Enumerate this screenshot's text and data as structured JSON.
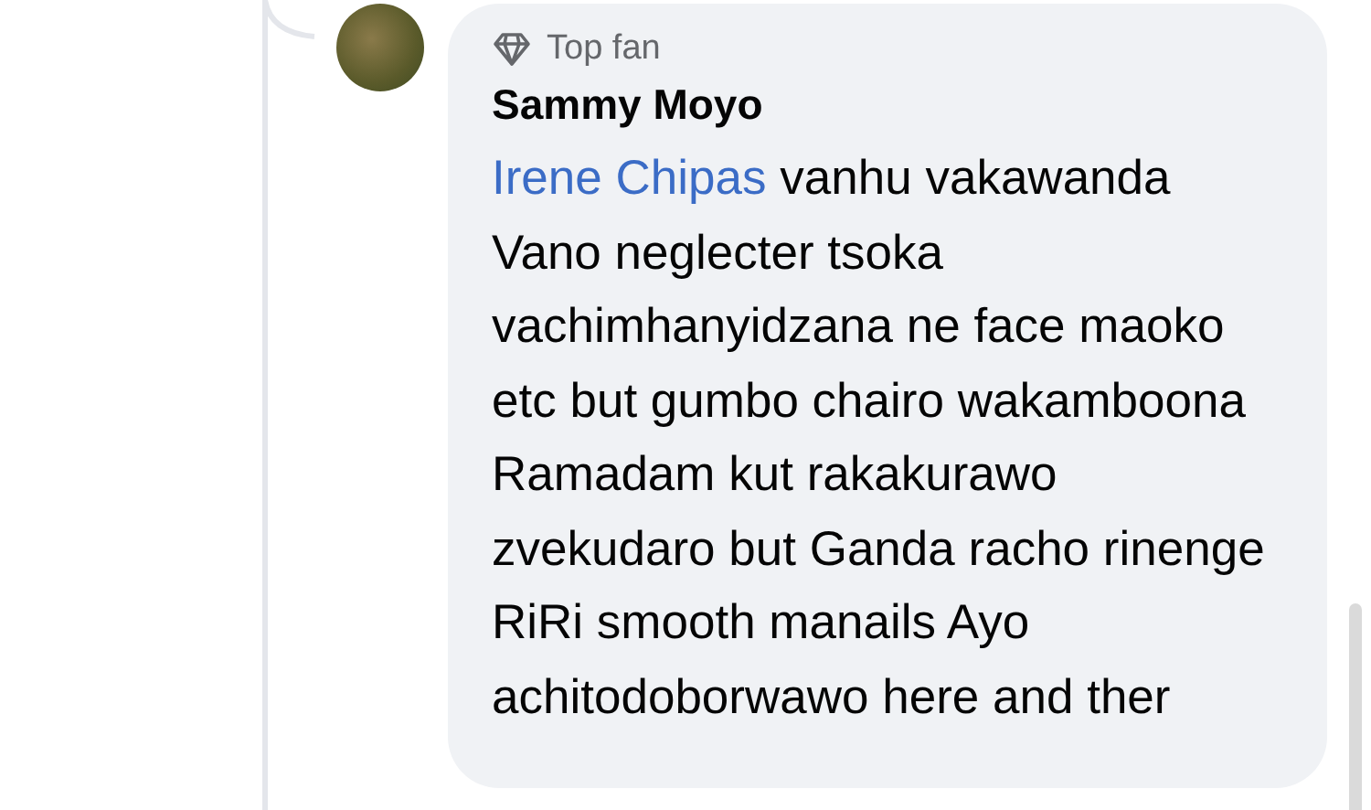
{
  "comment": {
    "badge": "Top fan",
    "author": "Sammy Moyo",
    "mention": "Irene Chipas",
    "text": "vanhu vakawanda Vano neglecter tsoka vachimhanyidzana ne face maoko etc but gumbo chairo wakamboona Ramadam kut rakakurawo zvekudaro but Ganda racho rinenge RiRi smooth manails Ayo achitodoborwawo here and ther"
  }
}
